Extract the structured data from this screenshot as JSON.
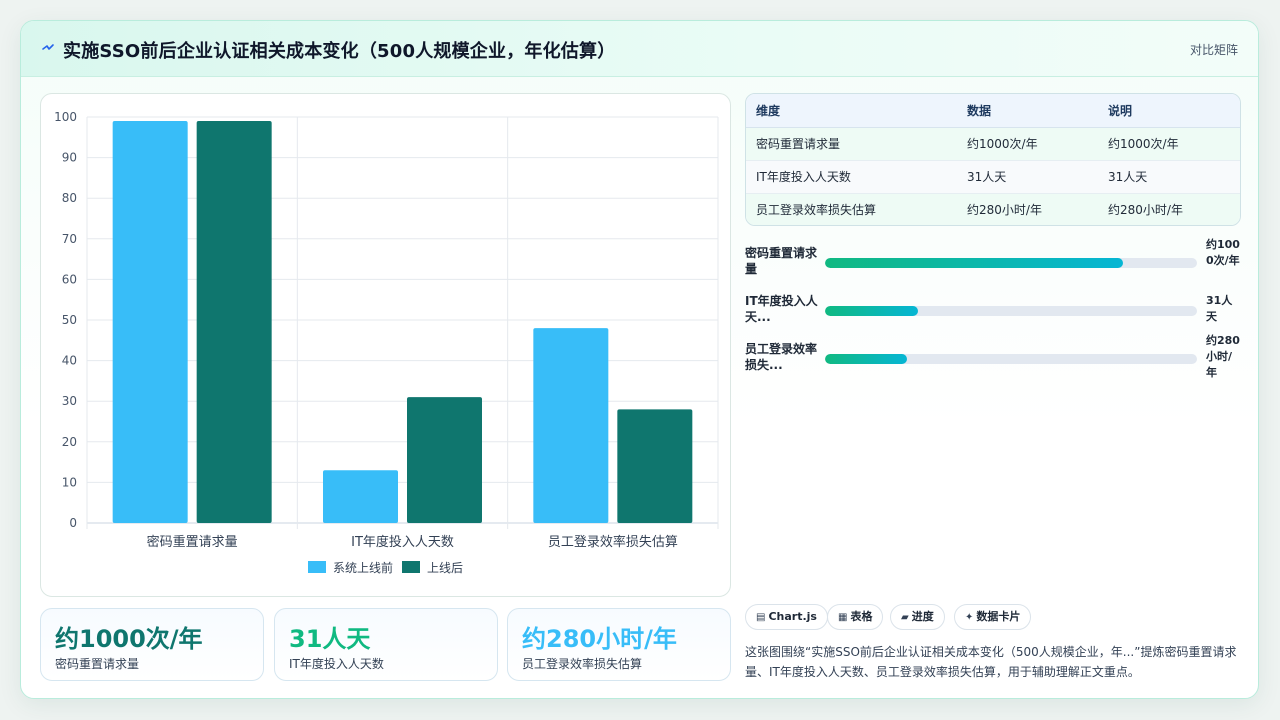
{
  "header": {
    "title": "实施SSO前后企业认证相关成本变化（500人规模企业，年化估算）",
    "icon": "sparkle-icon",
    "right_label": "对比矩阵"
  },
  "colors": {
    "before": "#38bdf8",
    "after": "#0f766e",
    "kpi_1": "#0f766e",
    "kpi_2": "#10b981",
    "kpi_3": "#38bdf8"
  },
  "chart_data": {
    "type": "bar",
    "categories": [
      "密码重置请求量",
      "IT年度投入人天数",
      "员工登录效率损失估算"
    ],
    "series": [
      {
        "name": "系统上线前",
        "values": [
          99,
          13,
          48
        ]
      },
      {
        "name": "上线后",
        "values": [
          99,
          31,
          28
        ]
      }
    ],
    "ylim": [
      0,
      100
    ],
    "yticks": [
      0,
      10,
      20,
      30,
      40,
      50,
      60,
      70,
      80,
      90,
      100
    ],
    "grid": true,
    "legend": "bottom"
  },
  "kpis": [
    {
      "value": "约1000次/年",
      "label": "密码重置请求量"
    },
    {
      "value": "31人天",
      "label": "IT年度投入人天数"
    },
    {
      "value": "约280小时/年",
      "label": "员工登录效率损失估算"
    }
  ],
  "table": {
    "headers": [
      "维度",
      "数据",
      "说明"
    ],
    "rows": [
      [
        "密码重置请求量",
        "约1000次/年",
        "约1000次/年"
      ],
      [
        "IT年度投入人天数",
        "31人天",
        "31人天"
      ],
      [
        "员工登录效率损失估算",
        "约280小时/年",
        "约280小时/年"
      ]
    ]
  },
  "progress": [
    {
      "label": "密码重置请求量",
      "value": "约1000次/年",
      "fraction": 0.8
    },
    {
      "label": "IT年度投入人天...",
      "value": "31人天",
      "fraction": 0.25
    },
    {
      "label": "员工登录效率损失...",
      "value": "约280小时/年",
      "fraction": 0.22
    }
  ],
  "chips": [
    {
      "icon": "chart-icon",
      "glyph": "▤",
      "label": "Chart.js"
    },
    {
      "icon": "table-icon",
      "glyph": "▦",
      "label": "表格"
    },
    {
      "icon": "progress-icon",
      "glyph": "▰",
      "label": "进度"
    },
    {
      "icon": "card-icon",
      "glyph": "✦",
      "label": "数据卡片"
    }
  ],
  "caption": "这张图围绕“实施SSO前后企业认证相关成本变化（500人规模企业，年...”提炼密码重置请求量、IT年度投入人天数、员工登录效率损失估算，用于辅助理解正文重点。"
}
